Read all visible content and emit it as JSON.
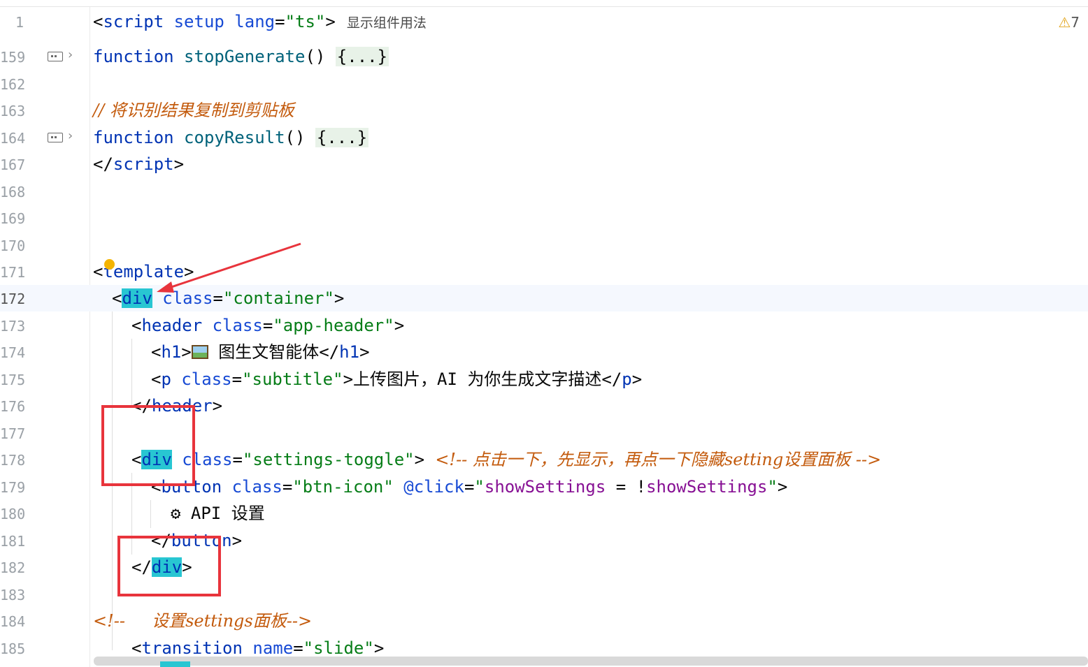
{
  "editor": {
    "warning_count": "7",
    "warning_icon": "warning-triangle-icon",
    "lines": {
      "l1": {
        "num": "1",
        "p1": "<",
        "t1": "script",
        "a1": " setup lang",
        "p2": "=",
        "s1": "\"ts\"",
        "p3": ">",
        "inlay": "显示组件用法"
      },
      "l159": {
        "num": "159",
        "k": "function",
        "f": " stopGenerate",
        "p": "() ",
        "fold": "{...}"
      },
      "l162": {
        "num": "162"
      },
      "l163": {
        "num": "163",
        "cmt": "// 将识别结果复制到剪贴板"
      },
      "l164": {
        "num": "164",
        "k": "function",
        "f": " copyResult",
        "p": "() ",
        "fold": "{...}"
      },
      "l167": {
        "num": "167",
        "p1": "</",
        "t1": "script",
        "p2": ">"
      },
      "l168": {
        "num": "168"
      },
      "l169": {
        "num": "169"
      },
      "l170": {
        "num": "170"
      },
      "l171": {
        "num": "171",
        "p1": "<",
        "t1": "template",
        "p2": ">"
      },
      "l172": {
        "num": "172",
        "p1": "<",
        "t1": "div",
        "a1": " class",
        "p2": "=",
        "s1": "\"container\"",
        "p3": ">"
      },
      "l173": {
        "num": "173",
        "p1": "<",
        "t1": "header",
        "a1": " class",
        "p2": "=",
        "s1": "\"app-header\"",
        "p3": ">"
      },
      "l174": {
        "num": "174",
        "p1": "<",
        "t1": "h1",
        "p2": ">",
        "txt": " 图生文智能体",
        "p3": "</",
        "t2": "h1",
        "p4": ">"
      },
      "l175": {
        "num": "175",
        "p1": "<",
        "t1": "p",
        "a1": " class",
        "p2": "=",
        "s1": "\"subtitle\"",
        "p3": ">",
        "txt": "上传图片，AI 为你生成文字描述",
        "p4": "</",
        "t2": "p",
        "p5": ">"
      },
      "l176": {
        "num": "176",
        "p1": "</",
        "t1": "header",
        "p2": ">"
      },
      "l177": {
        "num": "177"
      },
      "l178": {
        "num": "178",
        "p1": "<",
        "t1": "div",
        "a1": " class",
        "p2": "=",
        "s1": "\"settings-toggle\"",
        "p3": ">",
        "cmt": "  <!-- 点击一下，先显示，再点一下隐藏setting设置面板 -->"
      },
      "l179": {
        "num": "179",
        "p1": "<",
        "t1": "button",
        "a1": " class",
        "p2": "=",
        "s1": "\"btn-icon\"",
        "a2": " @click",
        "p3": "=",
        "q1": "\"",
        "v1": "showSettings",
        "o": " = !",
        "v2": "showSettings",
        "q2": "\"",
        "p4": ">"
      },
      "l180": {
        "num": "180",
        "gear": "⚙",
        "txt": " API 设置"
      },
      "l181": {
        "num": "181",
        "p1": "</",
        "t1": "button",
        "p2": ">"
      },
      "l182": {
        "num": "182",
        "p1": "</",
        "t1": "div",
        "p2": ">"
      },
      "l183": {
        "num": "183"
      },
      "l184": {
        "num": "184",
        "cmt": "<!--     设置settings面板-->"
      },
      "l185": {
        "num": "185",
        "p1": "<",
        "t1": "transition",
        "a1": " name",
        "p2": "=",
        "s1": "\"slide\"",
        "p3": ">"
      }
    }
  }
}
